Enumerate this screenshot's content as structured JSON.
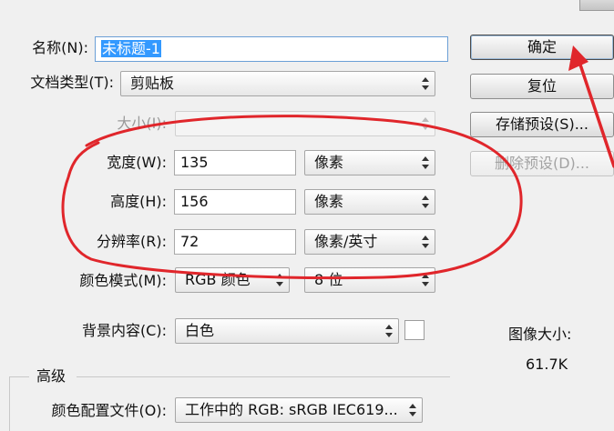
{
  "form": {
    "name_label": "名称(N):",
    "name_value": "未标题-1",
    "doc_type_label": "文档类型(T):",
    "doc_type_value": "剪贴板",
    "size_label": "大小(I):",
    "size_value": "",
    "width_label": "宽度(W):",
    "width_value": "135",
    "width_unit": "像素",
    "height_label": "高度(H):",
    "height_value": "156",
    "height_unit": "像素",
    "resolution_label": "分辨率(R):",
    "resolution_value": "72",
    "resolution_unit": "像素/英寸",
    "color_mode_label": "颜色模式(M):",
    "color_mode_value": "RGB 颜色",
    "bit_depth_value": "8 位",
    "background_label": "背景内容(C):",
    "background_value": "白色",
    "advanced_label": "高级",
    "color_profile_label": "颜色配置文件(O):",
    "color_profile_value": "工作中的 RGB: sRGB IEC619..."
  },
  "buttons": {
    "ok": "确定",
    "reset": "复位",
    "save_preset": "存储预设(S)...",
    "delete_preset": "删除预设(D)..."
  },
  "image_size": {
    "label": "图像大小:",
    "value": "61.7K"
  },
  "annotation": {
    "color": "#e0262b",
    "shape": "hand-drawn ellipse around width/height/resolution fields, arrow pointing at OK button"
  }
}
